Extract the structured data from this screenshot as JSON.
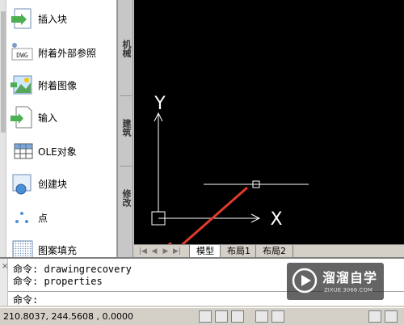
{
  "palette": {
    "items": [
      {
        "label": "插入块",
        "icon": "insert-block-icon"
      },
      {
        "label": "附着外部参照",
        "icon": "dwg-xref-icon",
        "icon_text": "DWG"
      },
      {
        "label": "附着图像",
        "icon": "attach-image-icon"
      },
      {
        "label": "输入",
        "icon": "import-icon"
      },
      {
        "label": "OLE对象",
        "icon": "ole-object-icon"
      },
      {
        "label": "创建块",
        "icon": "create-block-icon"
      },
      {
        "label": "点",
        "icon": "point-icon"
      },
      {
        "label": "图案填充",
        "icon": "hatch-icon"
      }
    ]
  },
  "side_tabs": {
    "mechanical": "机械",
    "architecture": "建筑",
    "modify": "修改"
  },
  "canvas": {
    "background": "#000000",
    "ucs_x_label": "X",
    "ucs_y_label": "Y",
    "annotation_arrow_color": "#e03a2a"
  },
  "layout_tabs": {
    "model": "模型",
    "layout1": "布局1",
    "layout2": "布局2"
  },
  "command": {
    "line1": "命令: drawingrecovery",
    "line2": "命令: properties",
    "prompt": "命令:"
  },
  "status": {
    "coordinates": "210.8037,  244.5608 , 0.0000"
  },
  "watermark": {
    "title": "溜溜自学",
    "subtitle": "ZIXUE.3066.COM"
  }
}
